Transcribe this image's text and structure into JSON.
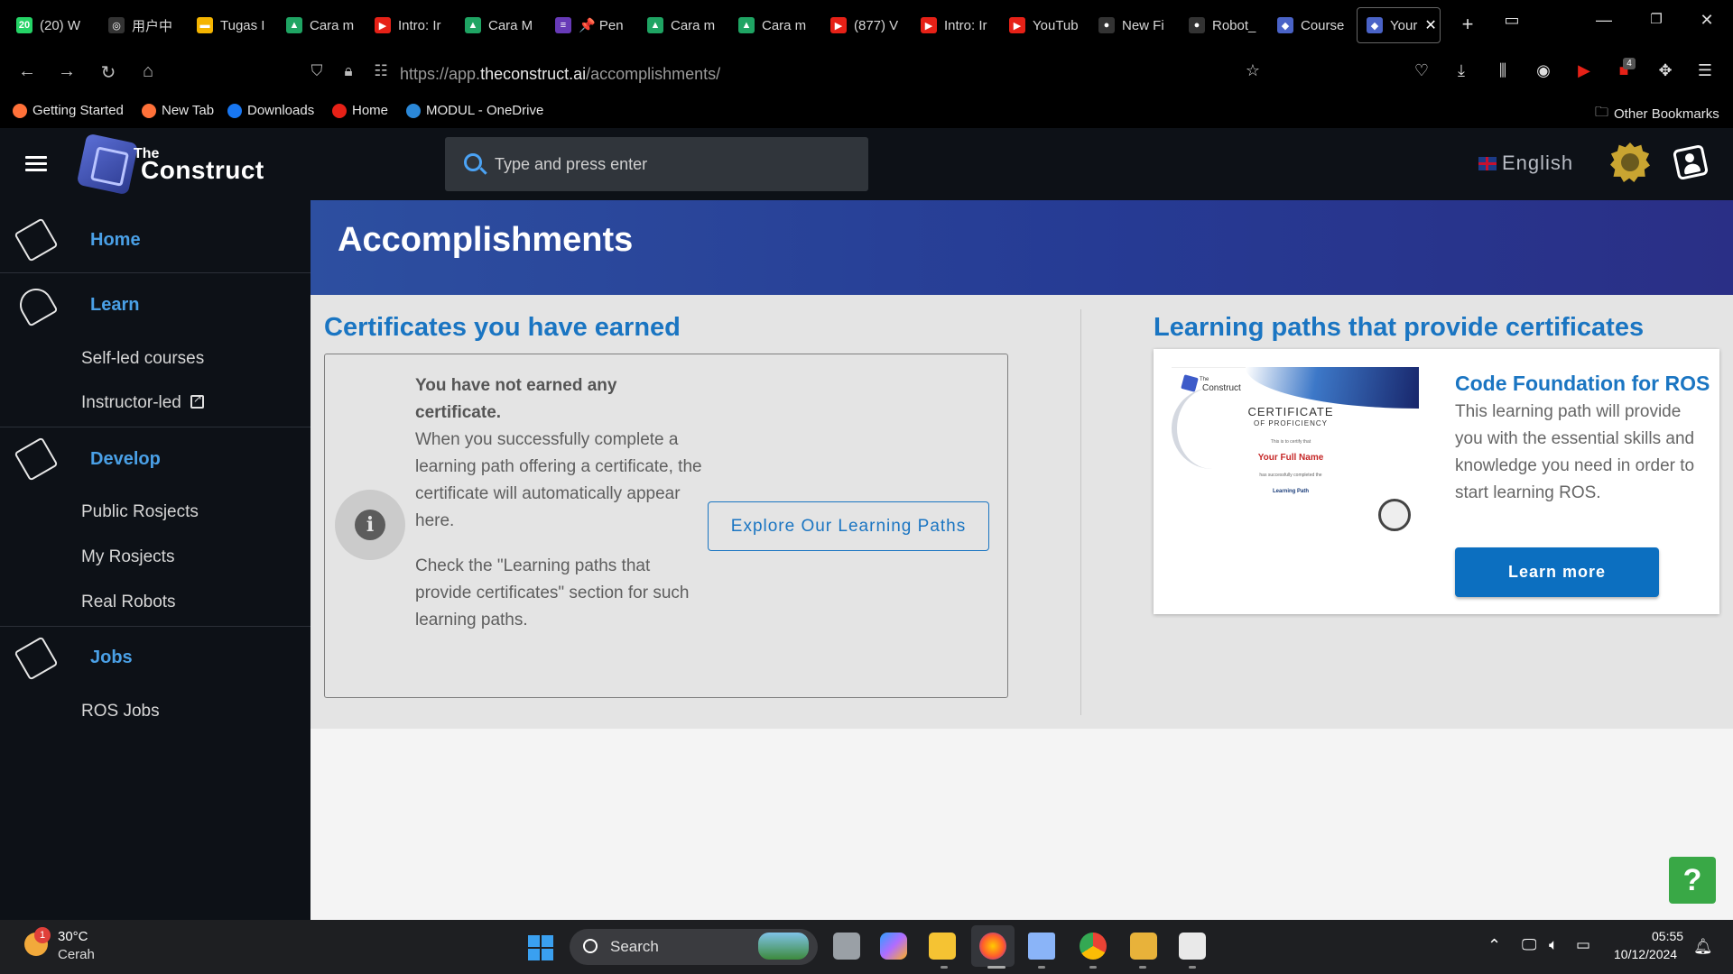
{
  "browser": {
    "tabs": [
      {
        "label": "(20) W",
        "icon": "whatsapp-icon",
        "color": "#25d366",
        "glyph": "20"
      },
      {
        "label": "用户中",
        "icon": "openai-icon",
        "color": "#333",
        "glyph": "◎"
      },
      {
        "label": "Tugas I",
        "icon": "slides-icon",
        "color": "#f4b400",
        "glyph": "▬"
      },
      {
        "label": "Cara m",
        "icon": "drive-icon",
        "color": "#1fa463",
        "glyph": "▲"
      },
      {
        "label": "Intro: Ir",
        "icon": "youtube-icon",
        "color": "#e62117",
        "glyph": "▶"
      },
      {
        "label": "Cara M",
        "icon": "drive-icon",
        "color": "#1fa463",
        "glyph": "▲"
      },
      {
        "label": "📌 Pen",
        "icon": "forms-icon",
        "color": "#673ab7",
        "glyph": "≡"
      },
      {
        "label": "Cara m",
        "icon": "drive-icon",
        "color": "#1fa463",
        "glyph": "▲"
      },
      {
        "label": "Cara m",
        "icon": "drive-icon",
        "color": "#1fa463",
        "glyph": "▲"
      },
      {
        "label": "(877) V",
        "icon": "youtube-icon",
        "color": "#e62117",
        "glyph": "▶"
      },
      {
        "label": "Intro: Ir",
        "icon": "youtube-icon",
        "color": "#e62117",
        "glyph": "▶"
      },
      {
        "label": "YouTub",
        "icon": "youtube-icon",
        "color": "#e62117",
        "glyph": "▶"
      },
      {
        "label": "New Fi",
        "icon": "github-icon",
        "color": "#333",
        "glyph": "●"
      },
      {
        "label": "Robot_",
        "icon": "github-icon",
        "color": "#333",
        "glyph": "●"
      },
      {
        "label": "Course",
        "icon": "construct-icon",
        "color": "#4a63c7",
        "glyph": "◆"
      },
      {
        "label": "Your",
        "icon": "construct-icon",
        "color": "#4a63c7",
        "glyph": "◆",
        "active": true
      }
    ],
    "url_prefix": "https://app.",
    "url_domain": "theconstruct.ai",
    "url_path": "/accomplishments/",
    "bookmarks": [
      {
        "label": "Getting Started",
        "color": "#ff7139"
      },
      {
        "label": "New Tab",
        "color": "#ff7139"
      },
      {
        "label": "Downloads",
        "color": "#1877f2"
      },
      {
        "label": "Home",
        "color": "#e62117"
      },
      {
        "label": "MODUL - OneDrive",
        "color": "#2b88d8"
      }
    ],
    "other_bookmarks": "Other Bookmarks",
    "extension_badge": "4"
  },
  "header": {
    "logo_the": "The",
    "logo_construct": "Construct",
    "search_placeholder": "Type and press enter",
    "language": "English"
  },
  "sidebar": {
    "sections": [
      {
        "head": "Home",
        "items": []
      },
      {
        "head": "Learn",
        "items": [
          "Self-led courses",
          "Instructor-led"
        ]
      },
      {
        "head": "Develop",
        "items": [
          "Public Rosjects",
          "My Rosjects",
          "Real Robots"
        ]
      },
      {
        "head": "Jobs",
        "items": [
          "ROS Jobs"
        ]
      }
    ]
  },
  "main": {
    "title": "Accomplishments",
    "certificates_heading": "Certificates you have earned",
    "no_cert_bold": "You have not earned any certificate.",
    "no_cert_text": "When you successfully complete a learning path offering a certificate, the certificate will automatically appear here.",
    "check_text": "Check the \"Learning paths that provide certificates\" section for such learning paths.",
    "explore_button": "Explore Our Learning Paths",
    "paths_heading": "Learning paths that provide certificates",
    "path_card": {
      "title": "Code Foundation for ROS",
      "description": "This learning path will provide you with the essential skills and knowledge you need in order to start learning ROS.",
      "button": "Learn more",
      "certificate": {
        "logo_the": "The",
        "logo_text": "Construct",
        "heading": "CERTIFICATE",
        "subheading": "OF PROFICIENCY",
        "certify_text": "This is to certify that",
        "name": "Your Full Name",
        "completed_text": "has successfully completed the",
        "course": "Learning Path"
      }
    },
    "help_button": "?"
  },
  "taskbar": {
    "temperature": "30°C",
    "weather": "Cerah",
    "weather_alert": "1",
    "search": "Search",
    "time": "05:55",
    "date": "10/12/2024"
  },
  "colors": {
    "accent": "#1a75c2",
    "sidebar_bg": "#0d1117",
    "banner": "#2d4fa0",
    "help": "#39a846"
  }
}
